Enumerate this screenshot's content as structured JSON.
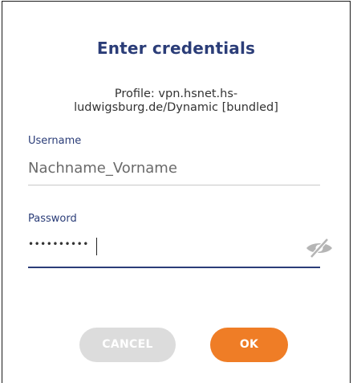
{
  "dialog": {
    "title": "Enter credentials",
    "profile_line1": "Profile: vpn.hsnet.hs-",
    "profile_line2": "ludwigsburg.de/Dynamic [bundled]"
  },
  "username": {
    "label": "Username",
    "value": "Nachname_Vorname"
  },
  "password": {
    "label": "Password",
    "masked_value": "••••••••••"
  },
  "icons": {
    "visibility_toggle": "eye-slash-icon"
  },
  "buttons": {
    "cancel_label": "CANCEL",
    "ok_label": "OK"
  },
  "colors": {
    "title": "#2b3d78",
    "accent": "#ef7d26",
    "cancel_disabled": "#dcdcdc",
    "active_underline": "#2b3d78"
  }
}
